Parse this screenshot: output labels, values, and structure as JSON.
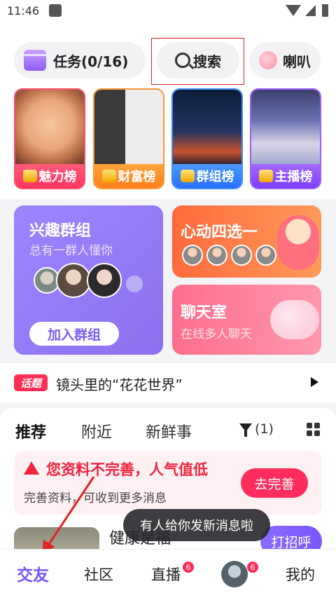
{
  "status_bar": {
    "time": "11:46"
  },
  "top_pills": {
    "task_label": "任务(0/16)",
    "search_label": "搜索",
    "horn_label": "喇叭"
  },
  "rank_cards": [
    {
      "label": "魅力榜"
    },
    {
      "label": "财富榜"
    },
    {
      "label": "群组榜"
    },
    {
      "label": "主播榜"
    }
  ],
  "interest_group": {
    "title": "兴趣群组",
    "subtitle": "总有一群人懂你",
    "join_label": "加入群组"
  },
  "heart_card": {
    "title": "心动四选一"
  },
  "chat_room": {
    "title": "聊天室",
    "subtitle": "在线多人聊天"
  },
  "topic": {
    "tag": "话题",
    "text": "镜头里的“花花世界”"
  },
  "feed_tabs": {
    "recommend": "推荐",
    "nearby": "附近",
    "fresh": "新鲜事",
    "filter_count": "(1)"
  },
  "warning": {
    "title": "您资料不完善，人气值低",
    "subtitle": "完善资料，可收到更多消息",
    "button": "去完善"
  },
  "user_card": {
    "name": "健康是福",
    "greet_button": "打招呼"
  },
  "toast": {
    "text": "有人给你发新消息啦"
  },
  "bottom_nav": {
    "friends": "交友",
    "community": "社区",
    "live": "直播",
    "live_badge": "6",
    "messages_badge": "6",
    "mine": "我的"
  },
  "colors": {
    "accent": "#7a55ff",
    "alert": "#f0243f",
    "highlight_box": "#e02020"
  }
}
